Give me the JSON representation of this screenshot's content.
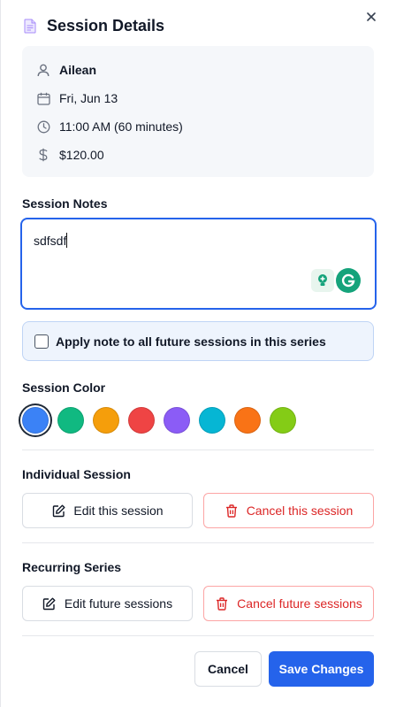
{
  "header": {
    "title": "Session Details",
    "icon": "document-icon",
    "close_icon": "close-icon"
  },
  "info": {
    "client_name": "Ailean",
    "date": "Fri, Jun 13",
    "time": "11:00 AM (60 minutes)",
    "price": "$120.00"
  },
  "notes": {
    "label": "Session Notes",
    "value": "sdfsdf"
  },
  "apply_all": {
    "label": "Apply note to all future sessions in this series",
    "checked": false
  },
  "color": {
    "label": "Session Color",
    "selected": "#3b82f6",
    "swatches": [
      "#3b82f6",
      "#10b981",
      "#f59e0b",
      "#ef4444",
      "#8b5cf6",
      "#06b6d4",
      "#f97316",
      "#84cc16"
    ]
  },
  "individual": {
    "label": "Individual Session",
    "edit": "Edit this session",
    "cancel": "Cancel this session"
  },
  "recurring": {
    "label": "Recurring Series",
    "edit": "Edit future sessions",
    "cancel": "Cancel future sessions"
  },
  "footer": {
    "cancel": "Cancel",
    "save": "Save Changes"
  }
}
